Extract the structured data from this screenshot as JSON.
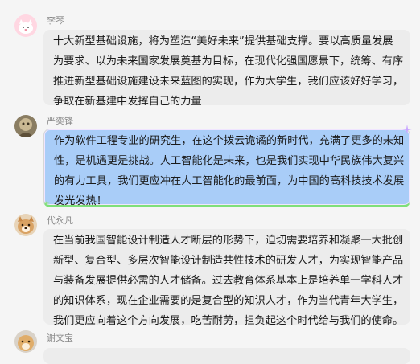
{
  "messages": [
    {
      "name": "李琴",
      "avatar": "cat-avatar",
      "lines": [
        "十大新型基础设施，将为塑造“美好未来”提供基础支撑。要以高质量发展",
        "为要求、以为未来国家发展奠基为目标，在现代化强国愿景下，统筹、有序",
        "推进新型基础设施建设未来蓝图的实现，作为大学生，我们应该好好学习，",
        "争取在新基建中发挥自己的力量"
      ]
    },
    {
      "name": "严奕锋",
      "avatar": "photo-avatar",
      "lines": [
        "作为软件工程专业的研究生，在这个拨云诡谲的新时代，充满了更多的未知",
        "性，是机遇更是挑战。人工智能化是未来，也是我们实现中华民族伟大复兴",
        "的有力工具，我们更应冲在人工智能化的最前面，为中国的高科技技术发展",
        "发光发热！"
      ]
    },
    {
      "name": "代永凡",
      "avatar": "dog-avatar",
      "lines": [
        "在当前我国智能设计制造人才断层的形势下，迫切需要培养和凝聚一大批创",
        "新型、复合型、多层次智能设计制造共性技术的研发人才，为实现智能产品",
        "与装备发展提供必需的人才储备。过去教育体系基本上是培养单一学科人才",
        "的知识体系，现在企业需要的是复合型的知识人才，作为当代青年大学生，",
        "我们更应向着这个方向发展，吃苦耐劳，担负起这个时代给与我们的使命。"
      ]
    },
    {
      "name": "谢文宝",
      "avatar": "dog-avatar-2",
      "lines": []
    }
  ],
  "colors": {
    "bubble_gray": "#ececec",
    "bubble_blue": "#a9cdf8",
    "background": "#f5f5f5"
  }
}
